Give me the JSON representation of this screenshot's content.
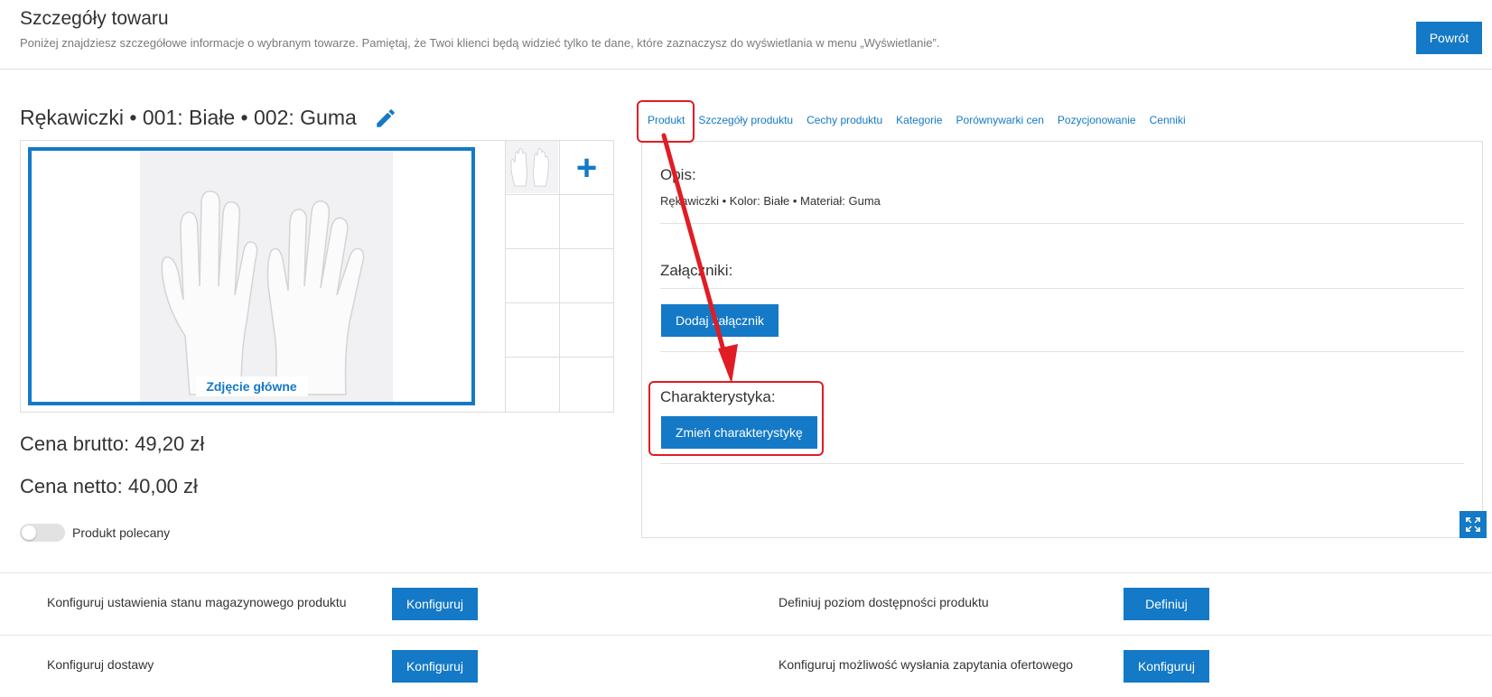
{
  "header": {
    "title": "Szczegóły towaru",
    "subtitle": "Poniżej znajdziesz szczegółowe informacje o wybranym towarze. Pamiętaj, że Twoi klienci będą widzieć tylko te dane, które zaznaczysz do wyświetlania w menu „Wyświetlanie”.",
    "back_label": "Powrót"
  },
  "product": {
    "title": "Rękawiczki • 001: Białe • 002: Guma",
    "main_photo_label": "Zdjęcie główne",
    "price_gross": "Cena brutto: 49,20 zł",
    "price_net": "Cena netto: 40,00 zł",
    "recommended_label": "Produkt polecany",
    "recommended_on": false
  },
  "tabs": [
    {
      "label": "Produkt"
    },
    {
      "label": "Szczegóły produktu"
    },
    {
      "label": "Cechy produktu"
    },
    {
      "label": "Kategorie"
    },
    {
      "label": "Porównywarki cen"
    },
    {
      "label": "Pozycjonowanie"
    },
    {
      "label": "Cenniki"
    }
  ],
  "panel": {
    "description_label": "Opis:",
    "description_text": "Rękawiczki • Kolor: Białe • Materiał: Guma",
    "attachments_label": "Załączniki:",
    "add_attachment_label": "Dodaj załącznik",
    "characteristic_label": "Charakterystyka:",
    "change_characteristic_label": "Zmień charakterystykę"
  },
  "config": {
    "stock_label": "Konfiguruj ustawienia stanu magazynowego produktu",
    "stock_button": "Konfiguruj",
    "availability_label": "Definiuj poziom dostępności produktu",
    "availability_button": "Definiuj",
    "delivery_label": "Konfiguruj dostawy",
    "delivery_button": "Konfiguruj",
    "inquiry_label": "Konfiguruj możliwość wysłania zapytania ofertowego",
    "inquiry_button": "Konfiguruj"
  },
  "colors": {
    "accent": "#1479c6",
    "annotation": "#e11c24"
  },
  "icons": {
    "edit": "pencil-icon",
    "add_photo": "plus-icon",
    "fullscreen": "expand-icon"
  }
}
